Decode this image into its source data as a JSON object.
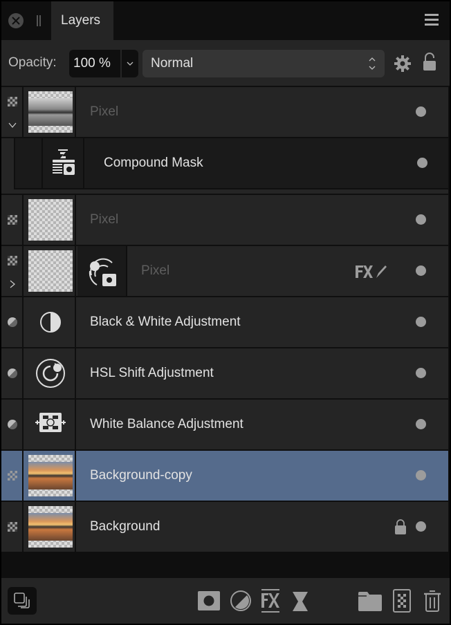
{
  "panel": {
    "tab_label": "Layers",
    "icons": {
      "close": "close-icon",
      "grip": "grip-icon",
      "menu": "hamburger-menu-icon"
    }
  },
  "opacity_bar": {
    "label": "Opacity:",
    "value": "100 %",
    "blend_mode": "Normal",
    "icons": {
      "dropdown": "chevron-down-icon",
      "blend_stepper": "up-down-chevron-icon",
      "settings": "gear-icon",
      "lock": "lock-icon"
    }
  },
  "layers": [
    {
      "name": "Pixel",
      "type": "pixel",
      "dimmed": true,
      "expanded": true,
      "thumbnail": "bw-seascape",
      "visible": true
    },
    {
      "name": "Compound Mask",
      "type": "compound-mask",
      "dimmed": false,
      "child_of": 0,
      "visible": true
    },
    {
      "name": "Pixel",
      "type": "pixel",
      "dimmed": true,
      "thumbnail": "transparent",
      "visible": true
    },
    {
      "name": "Pixel",
      "type": "pixel",
      "dimmed": true,
      "collapsed": true,
      "thumbnail": "transparent",
      "mask_icon": "hsl-mask-icon",
      "badges": [
        "fx-icon",
        "brush-icon"
      ],
      "visible": true
    },
    {
      "name": "Black & White Adjustment",
      "type": "adjustment",
      "icon": "black-white-icon",
      "visible": true
    },
    {
      "name": "HSL Shift Adjustment",
      "type": "adjustment",
      "icon": "hsl-icon",
      "visible": true
    },
    {
      "name": "White Balance Adjustment",
      "type": "adjustment",
      "icon": "white-balance-icon",
      "visible": true
    },
    {
      "name": "Background-copy",
      "type": "pixel",
      "selected": true,
      "thumbnail": "sunset",
      "visible": true
    },
    {
      "name": "Background",
      "type": "pixel",
      "locked": true,
      "thumbnail": "sunset",
      "visible": true
    }
  ],
  "bottom_toolbar": {
    "buttons": [
      {
        "name": "layer-stack",
        "icon": "layers-icon"
      },
      {
        "name": "mask-layer",
        "icon": "mask-icon"
      },
      {
        "name": "adjustment",
        "icon": "adjustment-icon"
      },
      {
        "name": "layer-fx",
        "icon": "fx-icon"
      },
      {
        "name": "live-filter",
        "icon": "hourglass-filter-icon"
      },
      {
        "name": "add-group",
        "icon": "folder-icon"
      },
      {
        "name": "add-pixel-layer",
        "icon": "pixel-layer-icon"
      },
      {
        "name": "delete-layer",
        "icon": "trash-icon"
      }
    ]
  },
  "colors": {
    "panel_bg": "#252525",
    "dark_bg": "#0f0f0f",
    "selected": "#556b8c",
    "icon_gray": "#9c9c9c",
    "text": "#e2e2e2",
    "dim_text": "#5e5e5e"
  }
}
